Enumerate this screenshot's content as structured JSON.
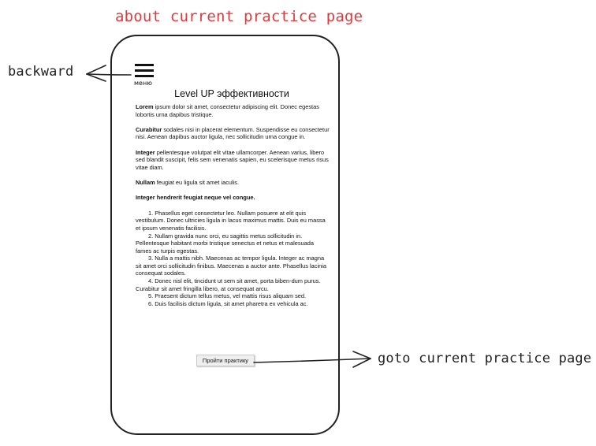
{
  "annotations": {
    "page_title": "about current practice page",
    "backward": "backward",
    "goto": "goto current practice page"
  },
  "screen": {
    "menu_label": "меню",
    "heading": "Level UP эффективности",
    "paragraphs": [
      {
        "lead": "Lorem",
        "text": " ipsum dolor sit amet, consectetur adipiscing elit. Donec egestas lobortis urna dapibus tristique."
      },
      {
        "lead": "Curabitur",
        "text": " sodales nisi in placerat elementum. Suspendisse eu consectetur nisi. Aenean dapibus auctor ligula, nec sollicitudin urna congue in."
      },
      {
        "lead": "Integer",
        "text": " pellentesque volutpat elit vitae ullamcorper. Aenean varius, libero sed blandit suscipit, felis sem venenatis sapien, eu scelerisque metus risus vitae diam."
      },
      {
        "lead": "Nullam",
        "text": " feugiat eu ligula sit amet iaculis."
      }
    ],
    "bold_line": "Integer hendrerit feugiat neque vel congue.",
    "list_items": [
      "1. Phasellus eget consectetur leo. Nullam posuere at elit quis vestibulum. Donec ultricies ligula in lacus maximus mattis. Duis eu massa et ipsum venenatis facilisis.",
      "2. Nullam gravida nunc orci, eu sagittis metus sollicitudin in. Pellentesque habitant morbi tristique senectus et netus et malesuada fames ac turpis egestas.",
      "3. Nulla a mattis nibh. Maecenas ac tempor ligula. Integer ac magna sit amet orci sollicitudin finibus. Maecenas a auctor ante. Phasellus lacinia consequat sodales.",
      "4. Donec nisl elit, tincidunt ut sem sit amet, porta biben-dum purus. Curabitur sit amet fringilla libero, at consequat arcu.",
      "5. Praesent dictum tellus metus, vel mattis risus aliquam sed.",
      "6. Duis facilisis dictum ligula, sit amet pharetra ex vehicula ac."
    ],
    "button_label": "Пройти практику"
  },
  "colors": {
    "title_note": "#e0393e",
    "ink": "#222222"
  }
}
